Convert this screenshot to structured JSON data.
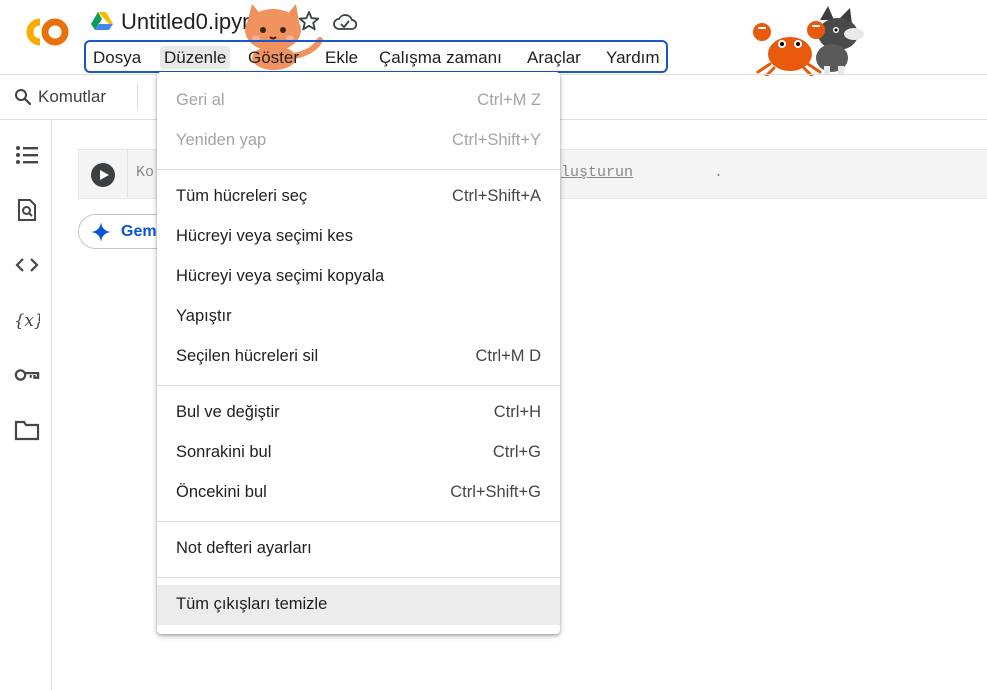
{
  "header": {
    "notebook_title": "Untitled0.ipynb"
  },
  "menubar": {
    "items": [
      "Dosya",
      "Düzenle",
      "Göster",
      "Ekle",
      "Çalışma zamanı",
      "Araçlar",
      "Yardım"
    ],
    "active": "Düzenle"
  },
  "toolbar": {
    "commands_label": "Komutlar"
  },
  "cell": {
    "placeholder_start": "Ko",
    "placeholder_link": "luşturun",
    "placeholder_end": "."
  },
  "gemini": {
    "label": "Gem"
  },
  "edit_menu": {
    "groups": [
      [
        {
          "label": "Geri al",
          "shortcut": "Ctrl+M Z",
          "disabled": true
        },
        {
          "label": "Yeniden yap",
          "shortcut": "Ctrl+Shift+Y",
          "disabled": true
        }
      ],
      [
        {
          "label": "Tüm hücreleri seç",
          "shortcut": "Ctrl+Shift+A"
        },
        {
          "label": "Hücreyi veya seçimi kes",
          "shortcut": ""
        },
        {
          "label": "Hücreyi veya seçimi kopyala",
          "shortcut": ""
        },
        {
          "label": "Yapıştır",
          "shortcut": ""
        },
        {
          "label": "Seçilen hücreleri sil",
          "shortcut": "Ctrl+M D"
        }
      ],
      [
        {
          "label": "Bul ve değiştir",
          "shortcut": "Ctrl+H"
        },
        {
          "label": "Sonrakini bul",
          "shortcut": "Ctrl+G"
        },
        {
          "label": "Öncekini bul",
          "shortcut": "Ctrl+Shift+G"
        }
      ],
      [
        {
          "label": "Not defteri ayarları",
          "shortcut": ""
        }
      ],
      [
        {
          "label": "Tüm çıkışları temizle",
          "shortcut": "",
          "hovered": true
        }
      ]
    ]
  },
  "sidebar": {
    "icons": [
      "table-of-contents-icon",
      "find-icon",
      "code-snippets-icon",
      "variables-icon",
      "secrets-key-icon",
      "files-folder-icon"
    ]
  },
  "colors": {
    "accent_blue": "#1a55c9",
    "logo_orange": "#f9ab00",
    "logo_dark_orange": "#e8710a",
    "gemini_blue": "#0b57d0"
  }
}
